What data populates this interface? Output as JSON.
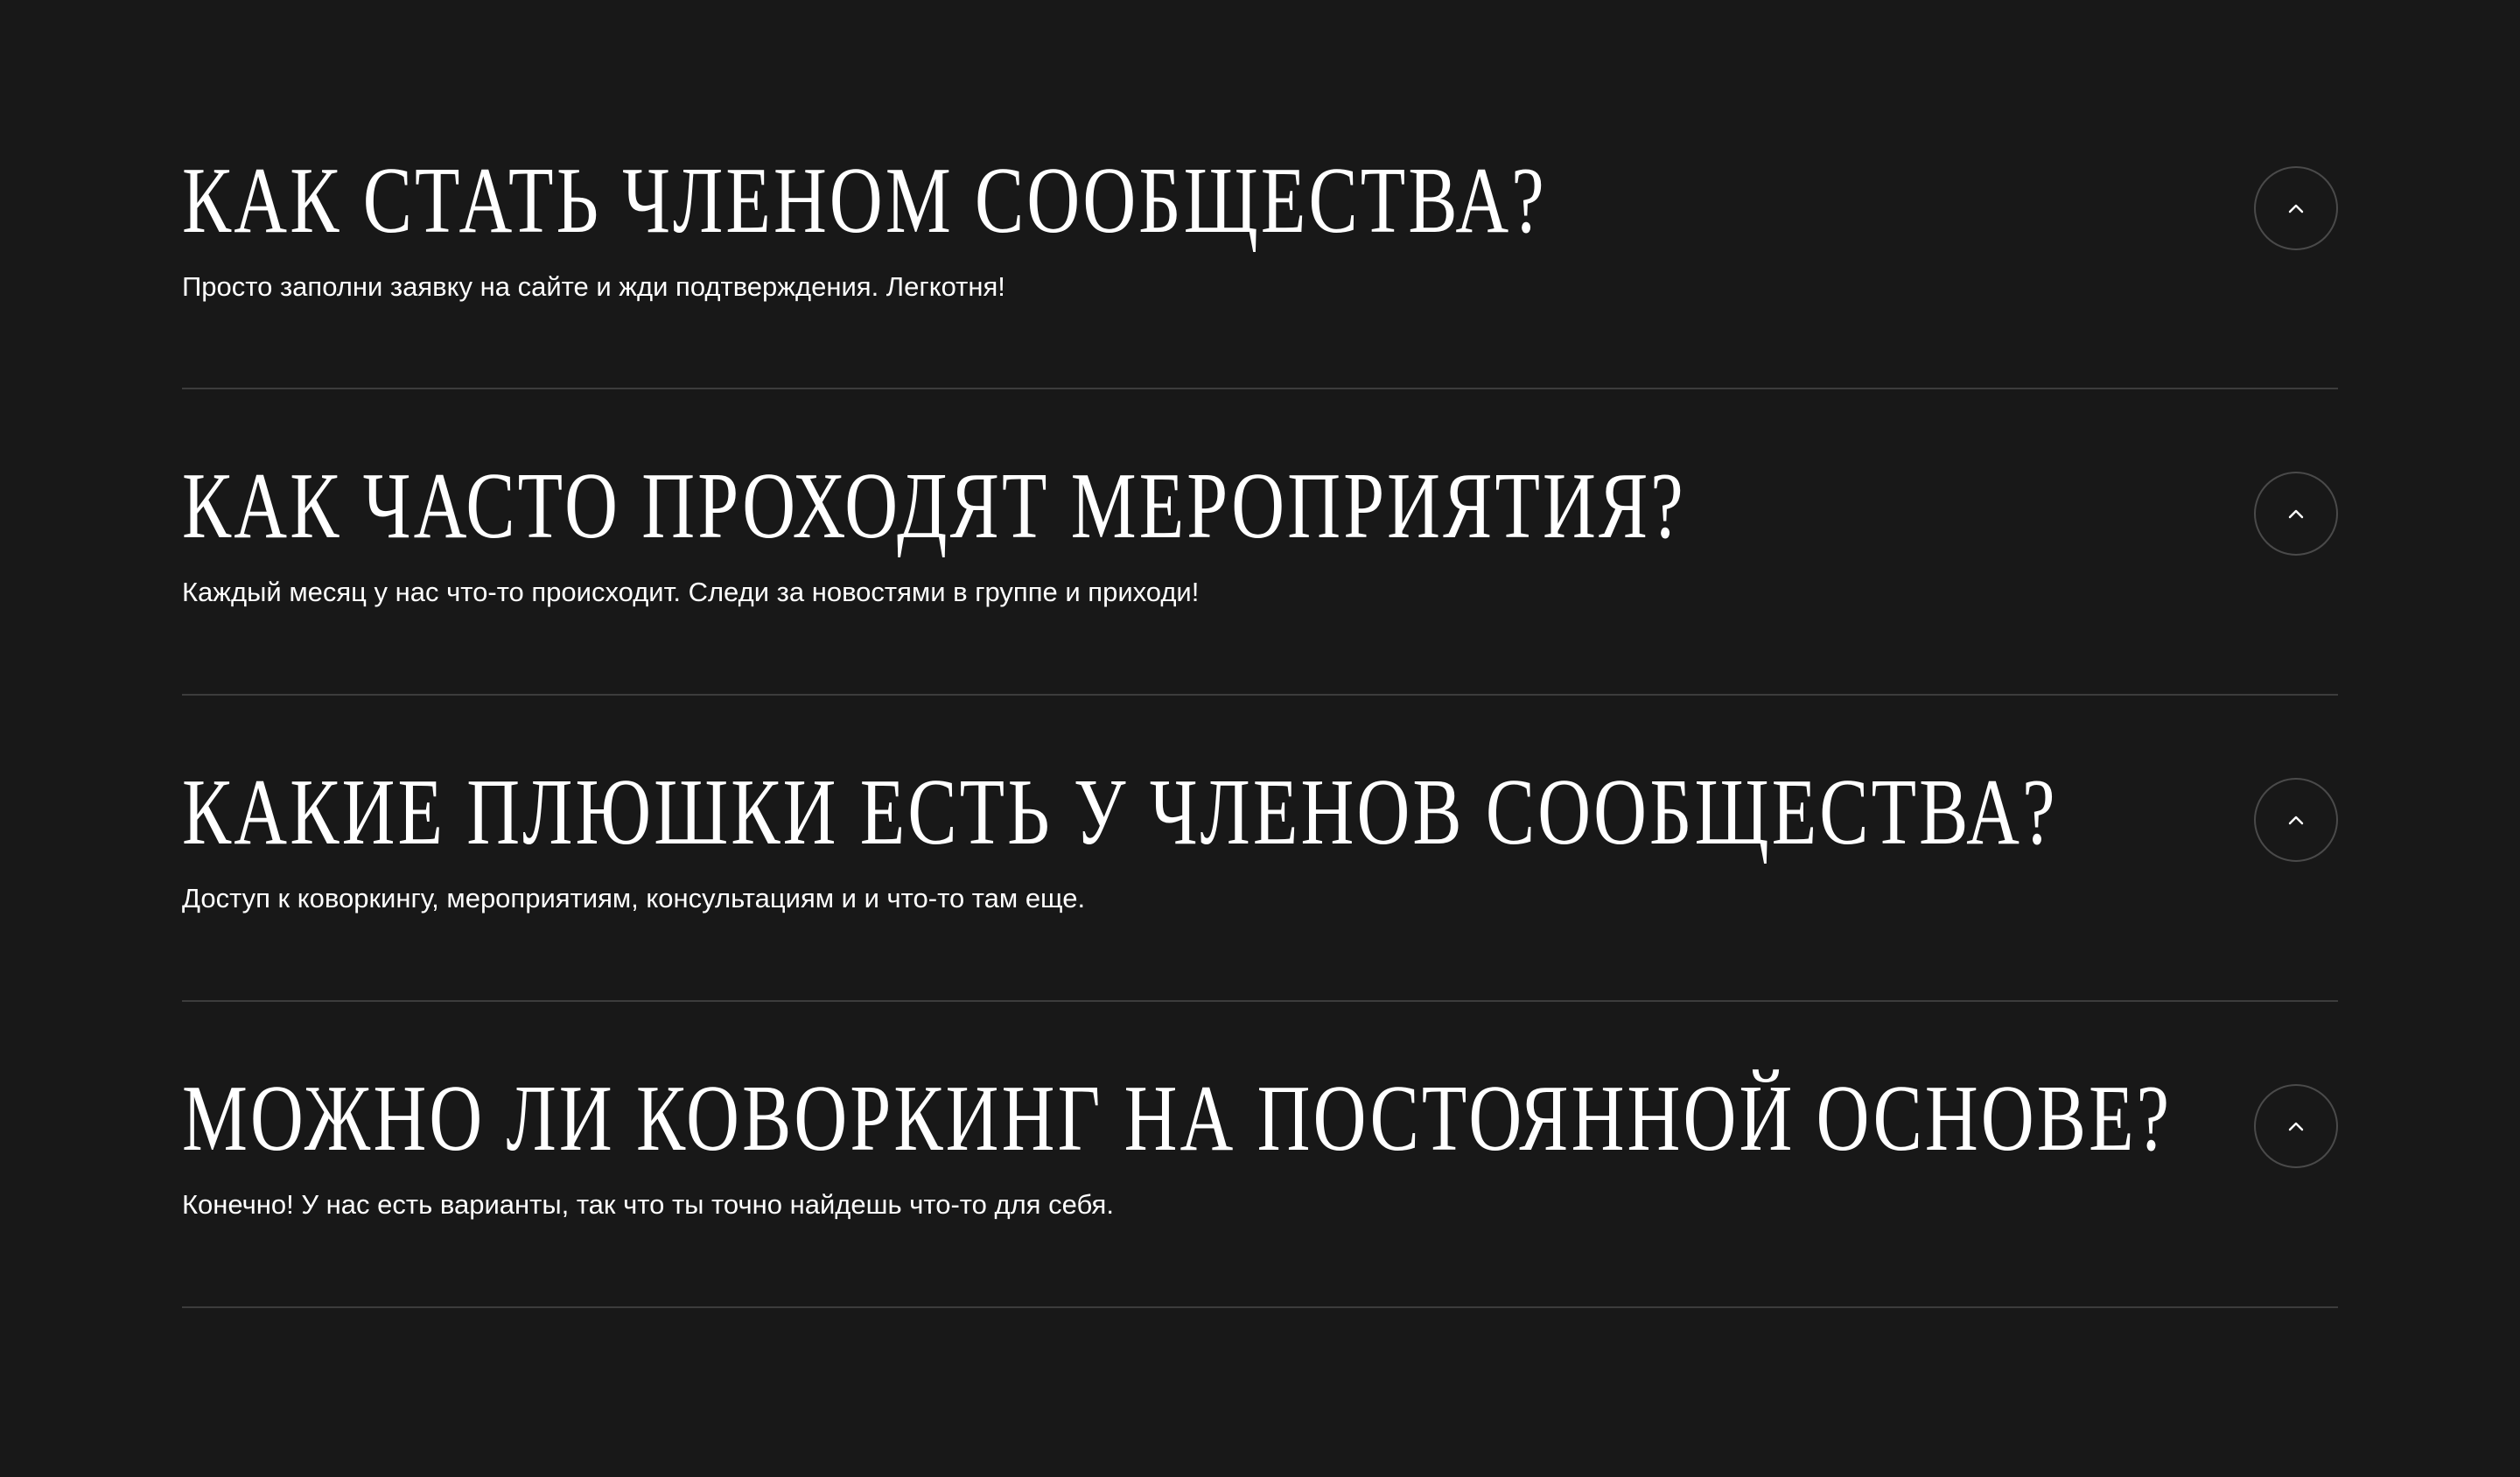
{
  "faq": {
    "items": [
      {
        "question": "КАК СТАТЬ ЧЛЕНОМ СООБЩЕСТВА?",
        "answer": "Просто заполни заявку на сайте и жди подтверждения. Легкотня!",
        "toggle_icon": "chevron-up-icon"
      },
      {
        "question": "КАК ЧАСТО ПРОХОДЯТ МЕРОПРИЯТИЯ?",
        "answer": "Каждый месяц у нас что-то происходит. Следи за новостями в группе и приходи!",
        "toggle_icon": "chevron-up-icon"
      },
      {
        "question": "КАКИЕ ПЛЮШКИ ЕСТЬ У ЧЛЕНОВ СООБЩЕСТВА?",
        "answer": "Доступ к коворкингу, мероприятиям, консультациям и и что-то там еще.",
        "toggle_icon": "chevron-up-icon"
      },
      {
        "question": "МОЖНО ЛИ КОВОРКИНГ НА ПОСТОЯННОЙ ОСНОВЕ?",
        "answer": "Конечно! У нас есть варианты, так что ты точно найдешь что-то для себя.",
        "toggle_icon": "chevron-up-icon"
      }
    ]
  },
  "colors": {
    "background": "#181818",
    "text": "#ffffff",
    "divider": "#3c3c3c",
    "toggle_border": "#4a4a4a"
  }
}
